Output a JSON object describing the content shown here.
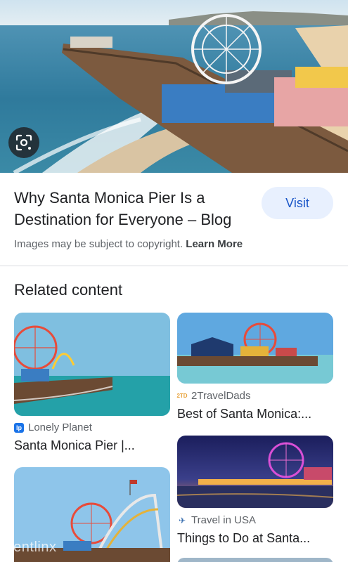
{
  "result": {
    "title": "Why Santa Monica Pier Is a Destination for Everyone – Blog",
    "visit_label": "Visit",
    "copyright_text": "Images may be subject to copyright.",
    "learn_more_label": "Learn More"
  },
  "related": {
    "heading": "Related content",
    "items": [
      {
        "source": "Lonely Planet",
        "title": "Santa Monica Pier |...",
        "favicon": "lp"
      },
      {
        "source": "2TravelDads",
        "title": "Best of Santa Monica:...",
        "favicon": "2TD"
      },
      {
        "source": "Travel in USA",
        "title": "Things to Do at Santa...",
        "favicon": "plane-icon"
      }
    ]
  },
  "watermark": "rentlinx",
  "colors": {
    "visit_bg": "#e8f0fe",
    "visit_text": "#1a56c8",
    "lonely_planet_blue": "#1a73e8"
  }
}
